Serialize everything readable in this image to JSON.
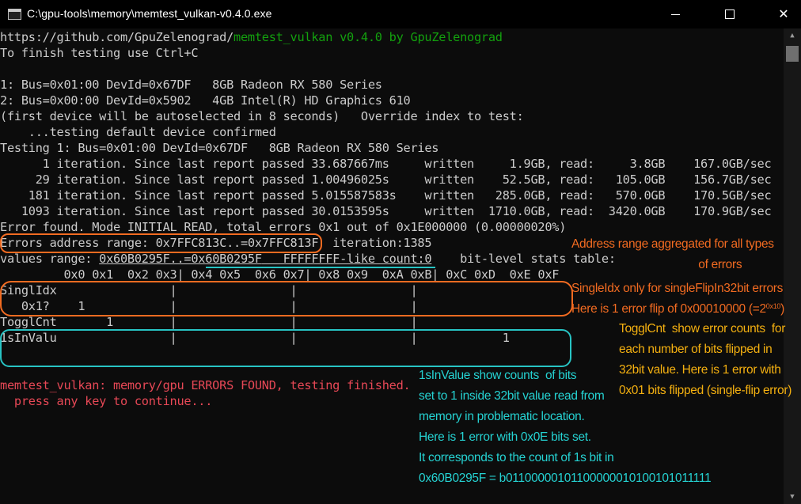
{
  "window": {
    "title": "C:\\gpu-tools\\memory\\memtest_vulkan-v0.4.0.exe",
    "minimize": "—",
    "close": "✕",
    "icon": "console-app-icon"
  },
  "console": {
    "url_prefix": "https://github.com/GpuZelenograd/",
    "url_suffix": "memtest_vulkan v0.4.0 by GpuZelenograd",
    "lines": [
      "To finish testing use Ctrl+C",
      "",
      "1: Bus=0x01:00 DevId=0x67DF   8GB Radeon RX 580 Series",
      "2: Bus=0x00:00 DevId=0x5902   4GB Intel(R) HD Graphics 610",
      "(first device will be autoselected in 8 seconds)   Override index to test:",
      "    ...testing default device confirmed",
      "Testing 1: Bus=0x01:00 DevId=0x67DF   8GB Radeon RX 580 Series",
      "      1 iteration. Since last report passed 33.687667ms     written     1.9GB, read:     3.8GB    167.0GB/sec",
      "     29 iteration. Since last report passed 1.00496025s     written    52.5GB, read:   105.0GB    156.7GB/sec",
      "    181 iteration. Since last report passed 5.015587583s    written   285.0GB, read:   570.0GB    170.5GB/sec",
      "   1093 iteration. Since last report passed 30.0153595s     written  1710.0GB, read:  3420.0GB    170.9GB/sec",
      "Error found. Mode INITIAL_READ, total errors 0x1 out of 0x1E000000 (0.00000020%)",
      "Errors address range: 0x7FFC813C..=0x7FFC813F  iteration:1385"
    ],
    "values_prefix": "values range: ",
    "values_range": "0x60B0295F..=0x60B0295F",
    "values_ff": "   FFFFFFFF-like count:0",
    "values_suffix": "    bit-level stats table:",
    "table": [
      "         0x0 0x1  0x2 0x3| 0x4 0x5  0x6 0x7| 0x8 0x9  0xA 0xB| 0xC 0xD  0xE 0xF",
      "SinglIdx                |                |                |",
      "   0x1?    1            |                |                |",
      "TogglCnt       1        |                |                |",
      "1sInValu                |                |                |            1"
    ],
    "error_msg": "memtest_vulkan: memory/gpu ERRORS FOUND, testing finished.",
    "continue_msg": "  press any key to continue..."
  },
  "annotations": {
    "address": "Address range aggregated for all types\n                                        of errors",
    "single_1": "SingleIdx only for singleFlipIn32bit errors",
    "single_2": "Here is 1 error flip of 0x00010000 (=2",
    "single_sup": "0x10",
    "single_3": ")",
    "toggl": "TogglCnt  show error counts  for\neach number of bits flipped in\n32bit value. Here is 1 error with\n0x01 bits flipped (single-flip error)",
    "ones": "1sInValue show counts  of bits\nset to 1 inside 32bit value read from\nmemory in problematic location.\nHere is 1 error with 0x0E bits set.\nIt corresponds to the count of 1s bit in\n0x60B0295F = b01100000101100000010100101011111"
  },
  "colors": {
    "background": "#0c0c0c",
    "text": "#cccccc",
    "green": "#13a10e",
    "red": "#e74856",
    "orange": "#f26b21",
    "yellow": "#f4b010",
    "cyan": "#25d2d2"
  }
}
